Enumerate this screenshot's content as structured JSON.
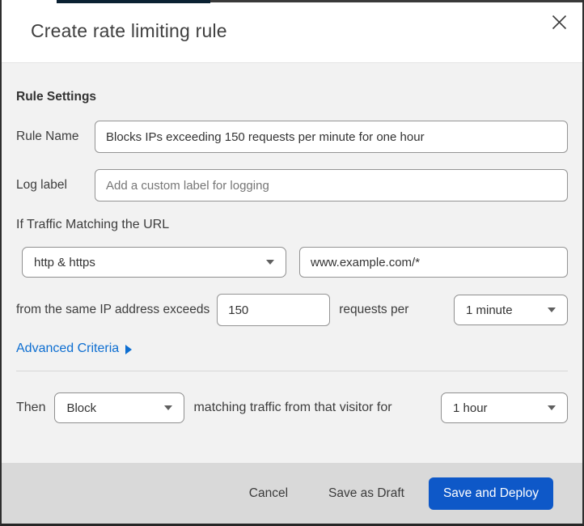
{
  "dialog": {
    "title": "Create rate limiting rule"
  },
  "icons": {
    "close": "x-mark",
    "select_caret": "triangle-down",
    "advanced_arrow": "triangle-right"
  },
  "rule_settings": {
    "heading": "Rule Settings",
    "rule_name": {
      "label": "Rule Name",
      "value": "Blocks IPs exceeding 150 requests per minute for one hour"
    },
    "log_label": {
      "label": "Log label",
      "placeholder": "Add a custom label for logging"
    }
  },
  "match": {
    "intro": "If Traffic Matching the URL",
    "scheme_selected": "http & https",
    "url_value": "www.example.com/*",
    "threshold_prefix": "from the same IP address exceeds",
    "threshold_value": "150",
    "threshold_suffix": "requests per",
    "period_selected": "1 minute",
    "advanced_link": "Advanced Criteria"
  },
  "action": {
    "then_label": "Then",
    "action_selected": "Block",
    "middle_text": "matching traffic from that visitor for",
    "duration_selected": "1 hour"
  },
  "footer": {
    "cancel_label": "Cancel",
    "save_draft_label": "Save as Draft",
    "save_deploy_label": "Save and Deploy"
  },
  "colors": {
    "primary_button": "#0e58c8",
    "link_blue": "#0d6ed1",
    "footer_bg": "#d9d9d9",
    "body_bg": "#f2f2f2",
    "top_sliver": "#0b2132",
    "border_dark": "#2e2e2e"
  }
}
